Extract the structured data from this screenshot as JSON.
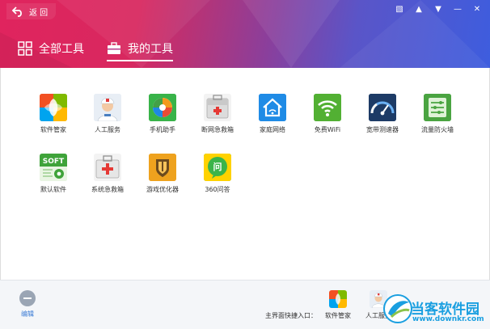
{
  "header": {
    "back_label": "返 回",
    "tabs": [
      {
        "label": "全部工具",
        "active": false
      },
      {
        "label": "我的工具",
        "active": true
      }
    ]
  },
  "tools": [
    {
      "label": "软件管家",
      "icon": "software-manager-icon"
    },
    {
      "label": "人工服务",
      "icon": "human-service-icon"
    },
    {
      "label": "手机助手",
      "icon": "phone-assistant-icon"
    },
    {
      "label": "断网急救箱",
      "icon": "network-first-aid-icon"
    },
    {
      "label": "家庭网络",
      "icon": "home-network-icon"
    },
    {
      "label": "免费WiFi",
      "icon": "free-wifi-icon"
    },
    {
      "label": "宽带测速器",
      "icon": "broadband-speed-icon"
    },
    {
      "label": "流量防火墙",
      "icon": "traffic-firewall-icon"
    },
    {
      "label": "默认软件",
      "icon": "default-software-icon"
    },
    {
      "label": "系统急救箱",
      "icon": "system-first-aid-icon"
    },
    {
      "label": "游戏优化器",
      "icon": "game-optimizer-icon"
    },
    {
      "label": "360问答",
      "icon": "qa-360-icon"
    }
  ],
  "footer": {
    "edit_label": "编辑",
    "quick_entry_label": "主界面快捷入口：",
    "quick_items": [
      {
        "label": "软件管家"
      },
      {
        "label": "人工服务"
      }
    ]
  },
  "watermark": {
    "site": "当客软件园",
    "url": "www.downkr.com"
  },
  "colors": {
    "header_start": "#e0245e",
    "header_end": "#3e5dde",
    "link_blue": "#3a7bd5"
  }
}
